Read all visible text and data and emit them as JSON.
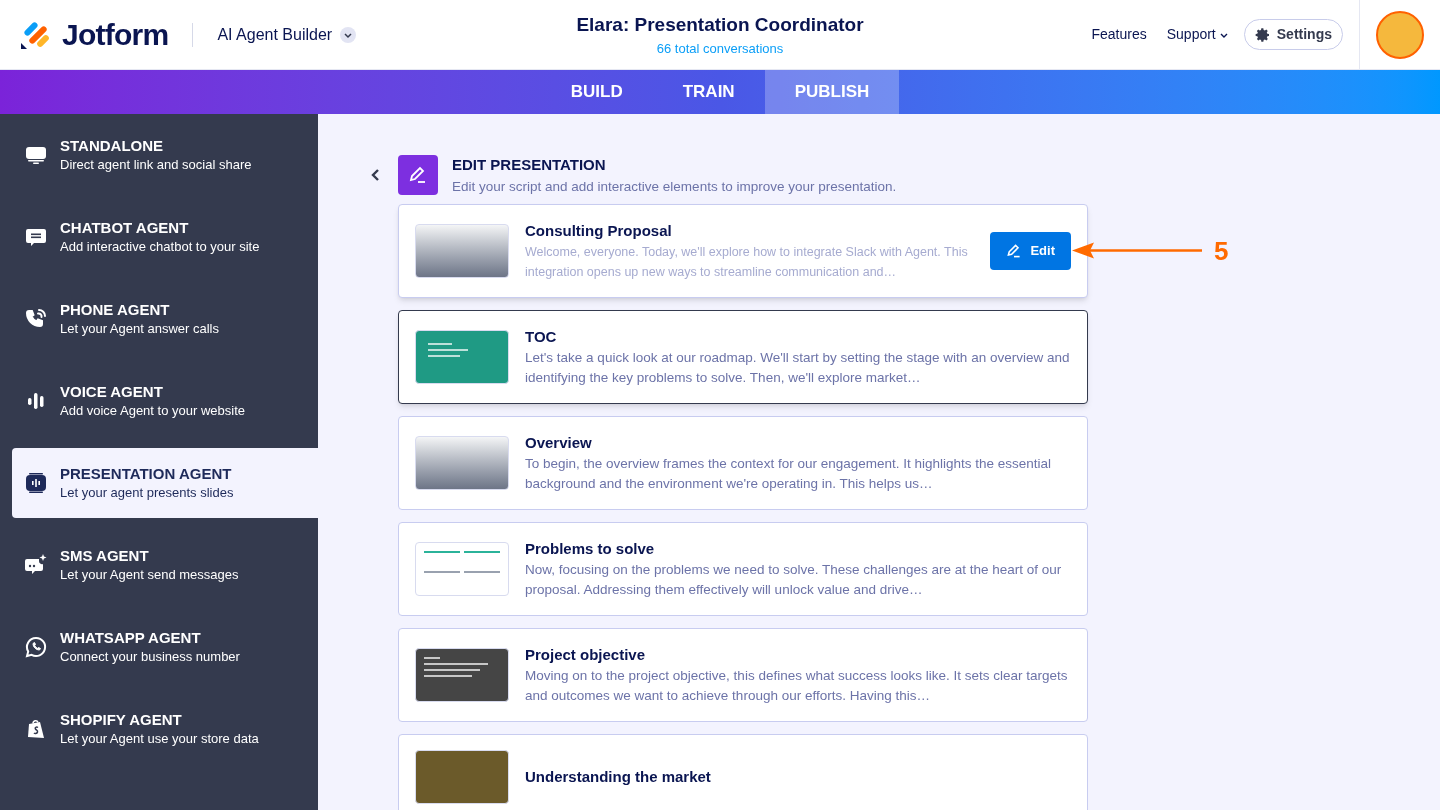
{
  "header": {
    "brand": "Jotform",
    "product": "AI Agent Builder",
    "agent_title": "Elara: Presentation Coordinator",
    "conversations": "66 total conversations",
    "links": [
      "Features",
      "Support"
    ],
    "settings": "Settings"
  },
  "tabs": [
    {
      "label": "BUILD",
      "selected": false
    },
    {
      "label": "TRAIN",
      "selected": false
    },
    {
      "label": "PUBLISH",
      "selected": true
    }
  ],
  "sidebar": {
    "items": [
      {
        "kind": "standalone",
        "title": "STANDALONE",
        "subtitle": "Direct agent link and social share",
        "selected": false
      },
      {
        "kind": "chatbot",
        "title": "CHATBOT AGENT",
        "subtitle": "Add interactive chatbot to your site",
        "selected": false
      },
      {
        "kind": "phone",
        "title": "PHONE AGENT",
        "subtitle": "Let your Agent answer calls",
        "selected": false
      },
      {
        "kind": "voice",
        "title": "VOICE AGENT",
        "subtitle": "Add voice Agent to your website",
        "selected": false
      },
      {
        "kind": "presentation",
        "title": "PRESENTATION AGENT",
        "subtitle": "Let your agent presents slides",
        "selected": true
      },
      {
        "kind": "sms",
        "title": "SMS AGENT",
        "subtitle": "Let your Agent send messages",
        "selected": false
      },
      {
        "kind": "whatsapp",
        "title": "WHATSAPP AGENT",
        "subtitle": "Connect your business number",
        "selected": false
      },
      {
        "kind": "shopify",
        "title": "SHOPIFY AGENT",
        "subtitle": "Let your Agent use your store data",
        "selected": false
      }
    ]
  },
  "panel": {
    "title": "EDIT PRESENTATION",
    "subtitle": "Edit your script and add interactive elements to improve your presentation.",
    "slides": [
      {
        "kind": "light",
        "title": "Consulting Proposal",
        "description": "Welcome, everyone. Today, we'll explore how to integrate Slack with Agent. This integration opens up new ways to streamline communication and…",
        "hovered": true,
        "selected": false,
        "action": "Edit"
      },
      {
        "kind": "teal",
        "title": "TOC",
        "description": "Let's take a quick look at our roadmap. We'll start by setting the stage with an overview and identifying the key problems to solve. Then, we'll explore market…",
        "hovered": false,
        "selected": true
      },
      {
        "kind": "light",
        "title": "Overview",
        "description": "To begin, the overview frames the context for our engagement. It highlights the essential background and the environment we're operating in. This helps us…",
        "hovered": false,
        "selected": false
      },
      {
        "kind": "white",
        "title": "Problems to solve",
        "description": "Now, focusing on the problems we need to solve. These challenges are at the heart of our proposal. Addressing them effectively will unlock value and drive…",
        "hovered": false,
        "selected": false
      },
      {
        "kind": "dark",
        "title": "Project objective",
        "description": "Moving on to the project objective, this defines what success looks like. It sets clear targets and outcomes we want to achieve through our efforts. Having this…",
        "hovered": false,
        "selected": false
      },
      {
        "kind": "photo",
        "title": "Understanding the market",
        "hovered": false,
        "selected": false
      }
    ]
  },
  "annotation": {
    "label": "5"
  }
}
